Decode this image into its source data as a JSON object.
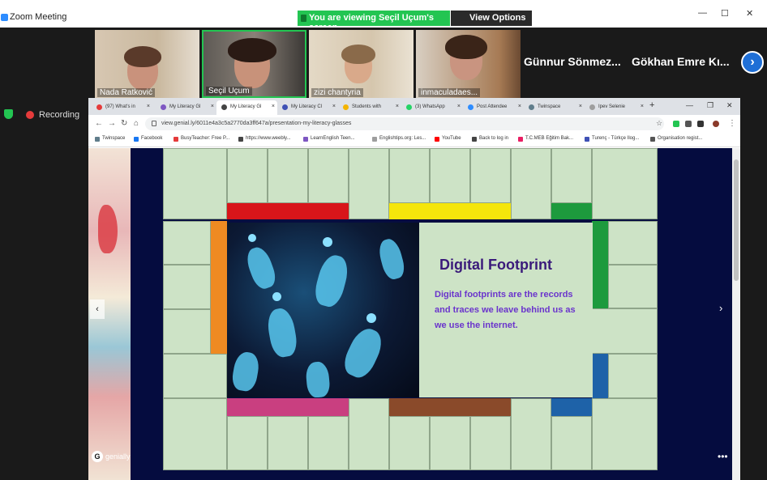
{
  "zoom": {
    "title": "Zoom Meeting",
    "banner": "You are viewing Seçil Uçum's screen",
    "view_options": "View Options ▾",
    "recording_label": "Recording",
    "next_arrow": "›",
    "win_min": "—",
    "win_max": "☐",
    "win_close": "✕"
  },
  "participants": [
    {
      "name": "Nada Ratković"
    },
    {
      "name": "Seçil Uçum"
    },
    {
      "name": "zizi chantyria"
    },
    {
      "name": "inmaculadaes..."
    }
  ],
  "name_tiles": [
    {
      "name": "Günnur Sönmez..."
    },
    {
      "name": "Gökhan Emre Kı..."
    }
  ],
  "browser": {
    "tabs": [
      {
        "label": "(97) What's in",
        "color": "#e53b3b"
      },
      {
        "label": "My Literacy Gl",
        "color": "#7e57c2"
      },
      {
        "label": "My Literacy Gl",
        "color": "#444444"
      },
      {
        "label": "My Literacy Cl",
        "color": "#3f51b5"
      },
      {
        "label": "Students with",
        "color": "#f4b400"
      },
      {
        "label": "(3) WhatsApp",
        "color": "#25d366"
      },
      {
        "label": "Post Attendee",
        "color": "#2d8cff"
      },
      {
        "label": "Twinspace",
        "color": "#607d8b"
      },
      {
        "label": "Ipev Selenie",
        "color": "#9e9e9e"
      }
    ],
    "new_tab": "+",
    "url": "view.genial.ly/6011e4a3c5a2770da3ff647a/presentation-my-literacy-glasses",
    "bookmarks": [
      {
        "label": "Twinspace",
        "color": "#607d8b"
      },
      {
        "label": "Facebook",
        "color": "#1877f2"
      },
      {
        "label": "BusyTeacher: Free P...",
        "color": "#e53b3b"
      },
      {
        "label": "https://www.weebly...",
        "color": "#444444"
      },
      {
        "label": "LearnEnglish Teen...",
        "color": "#7e57c2"
      },
      {
        "label": "Englishtips.org: Les...",
        "color": "#9e9e9e"
      },
      {
        "label": "YouTube",
        "color": "#ff0000"
      },
      {
        "label": "Back to log in",
        "color": "#444444"
      },
      {
        "label": "T.C.MEB Eğitim Bak...",
        "color": "#e91e63"
      },
      {
        "label": "Turenç - Türkçe Ilog...",
        "color": "#3f51b5"
      },
      {
        "label": "Organisation regist...",
        "color": "#555555"
      }
    ]
  },
  "slide": {
    "title": "Digital Footprint",
    "body": "Digital footprints are the records and traces we leave behind us as we use the internet.",
    "brand": "genially",
    "prev": "‹",
    "next": "›",
    "more": "•••"
  }
}
